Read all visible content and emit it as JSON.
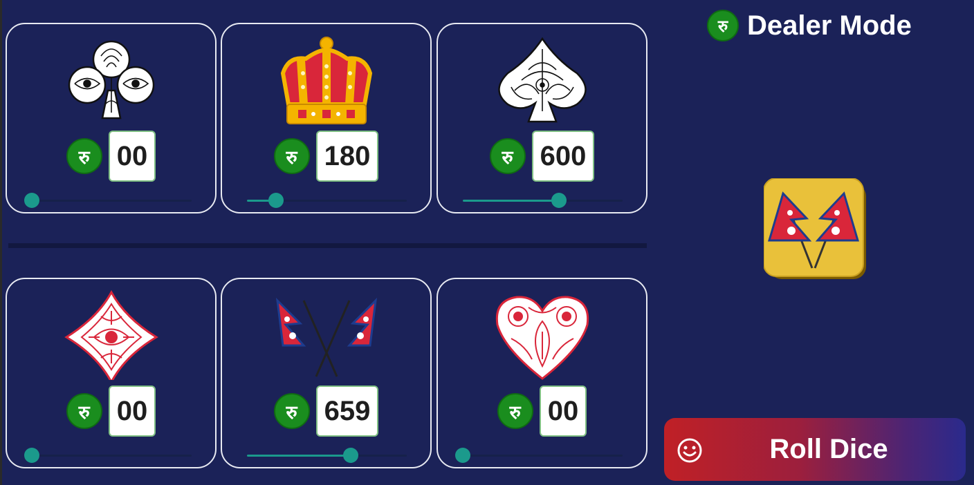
{
  "header": {
    "mode_label": "Dealer Mode",
    "currency_glyph": "रु"
  },
  "cards": [
    {
      "symbol": "club",
      "icon": "club-icon",
      "amount": "00",
      "slider_fraction": 0.0
    },
    {
      "symbol": "crown",
      "icon": "crown-icon",
      "amount": "180",
      "slider_fraction": 0.18
    },
    {
      "symbol": "spade",
      "icon": "spade-icon",
      "amount": "600",
      "slider_fraction": 0.6
    },
    {
      "symbol": "diamond",
      "icon": "diamond-icon",
      "amount": "00",
      "slider_fraction": 0.0
    },
    {
      "symbol": "flag",
      "icon": "nepal-flag-icon",
      "amount": "659",
      "slider_fraction": 0.65
    },
    {
      "symbol": "heart",
      "icon": "heart-icon",
      "amount": "00",
      "slider_fraction": 0.0
    }
  ],
  "dice": {
    "icon": "nepal-flag-dice-icon",
    "face": "flag"
  },
  "roll_button": {
    "label": "Roll Dice",
    "icon": "smiley-icon"
  },
  "colors": {
    "background": "#1b2258",
    "currency_green": "#1a8d1e",
    "slider_teal": "#1b9a8c",
    "crown_gold": "#f4b400",
    "suit_red": "#d9263a"
  }
}
